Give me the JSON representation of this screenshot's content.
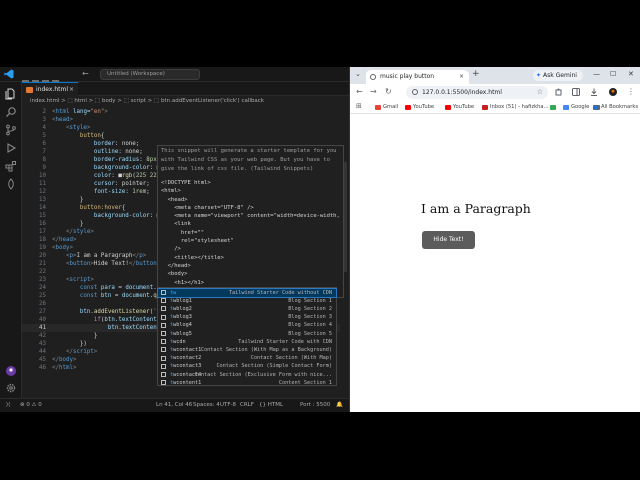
{
  "vscode": {
    "search_placeholder": "Untitled (Workspace)",
    "tab_label": "index.html",
    "tab_close": "×",
    "breadcrumb": "index.html > ⬚ html > ⬚ body > ⬚ script > ⬚ btn.addEventListener('click') callback",
    "lines": [
      {
        "n": "2",
        "html": "<span class='t-gray'>&lt;</span><span class='t-tag'>html</span> <span class='t-attr'>lang</span><span class='t-txt'>=</span><span class='t-str'>\"en\"</span><span class='t-gray'>&gt;</span>"
      },
      {
        "n": "3",
        "html": "<span class='t-gray'>&lt;</span><span class='t-tag'>head</span><span class='t-gray'>&gt;</span>"
      },
      {
        "n": "4",
        "html": "    <span class='t-gray'>&lt;</span><span class='t-tag'>style</span><span class='t-gray'>&gt;</span>"
      },
      {
        "n": "5",
        "html": "        <span class='t-sel'>button</span><span class='t-txt'>{</span>"
      },
      {
        "n": "6",
        "html": "            <span class='t-prop'>border</span><span class='t-txt'>: none;</span>"
      },
      {
        "n": "7",
        "html": "            <span class='t-prop'>outline</span><span class='t-txt'>: none;</span>"
      },
      {
        "n": "8",
        "html": "            <span class='t-prop'>border-radius</span><span class='t-txt'>: </span><span class='t-num'>8px</span><span class='t-txt'>;</span>"
      },
      {
        "n": "9",
        "html": "            <span class='t-prop'>background-color</span><span class='t-txt'>: □</span>"
      },
      {
        "n": "10",
        "html": "            <span class='t-prop'>color</span><span class='t-txt'>: ■</span><span class='t-fn'>rgb</span><span class='t-txt'>(</span><span class='t-num'>225 225</span>"
      },
      {
        "n": "11",
        "html": "            <span class='t-prop'>cursor</span><span class='t-txt'>: pointer;</span>"
      },
      {
        "n": "12",
        "html": "            <span class='t-prop'>font-size</span><span class='t-txt'>: </span><span class='t-num'>1rem</span><span class='t-txt'>;</span>"
      },
      {
        "n": "13",
        "html": "        <span class='t-txt'>}</span>"
      },
      {
        "n": "14",
        "html": "        <span class='t-sel'>button:hover</span><span class='t-txt'>{</span>"
      },
      {
        "n": "15",
        "html": "            <span class='t-prop'>background-color</span><span class='t-txt'>: □</span>"
      },
      {
        "n": "16",
        "html": "        <span class='t-txt'>}</span>"
      },
      {
        "n": "17",
        "html": "    <span class='t-gray'>&lt;/</span><span class='t-tag'>style</span><span class='t-gray'>&gt;</span>"
      },
      {
        "n": "18",
        "html": "<span class='t-gray'>&lt;/</span><span class='t-tag'>head</span><span class='t-gray'>&gt;</span>"
      },
      {
        "n": "19",
        "html": "<span class='t-gray'>&lt;</span><span class='t-tag'>body</span><span class='t-gray'>&gt;</span>"
      },
      {
        "n": "20",
        "html": "    <span class='t-gray'>&lt;</span><span class='t-tag'>p</span><span class='t-gray'>&gt;</span><span class='t-txt'>I am a Paragraph</span><span class='t-gray'>&lt;/</span><span class='t-tag'>p</span><span class='t-gray'>&gt;</span>"
      },
      {
        "n": "21",
        "html": "    <span class='t-gray'>&lt;</span><span class='t-tag'>button</span><span class='t-gray'>&gt;</span><span class='t-txt'>Hide Text!</span><span class='t-gray'>&lt;/</span><span class='t-tag'>button</span><span class='t-gray'>&gt;</span>"
      },
      {
        "n": "22",
        "html": ""
      },
      {
        "n": "23",
        "html": "    <span class='t-gray'>&lt;</span><span class='t-tag'>script</span><span class='t-gray'>&gt;</span>"
      },
      {
        "n": "24",
        "html": "        <span class='t-kw'>const</span> <span class='t-prop'>para</span> <span class='t-txt'>= </span><span class='t-prop'>document</span><span class='t-txt'>.</span><span class='t-fn'>que</span>"
      },
      {
        "n": "25",
        "html": "        <span class='t-kw'>const</span> <span class='t-prop'>btn</span> <span class='t-txt'>= </span><span class='t-prop'>document</span><span class='t-txt'>.</span><span class='t-fn'>que</span>"
      },
      {
        "n": "26",
        "html": ""
      },
      {
        "n": "27",
        "html": "        <span class='t-prop'>btn</span><span class='t-txt'>.</span><span class='t-fn'>addEventListener</span><span class='t-txt'>(</span><span class='t-str'>'cli</span>"
      },
      {
        "n": "40",
        "html": "            <span class='t-ctl'>if</span><span class='t-txt'>(</span><span class='t-prop'>btn</span><span class='t-txt'>.</span><span class='t-prop'>textContent</span> <span class='t-txt'>==</span>"
      },
      {
        "n": "41",
        "html": "                <span class='t-prop'>btn</span><span class='t-txt'>.</span><span class='t-prop'>textContent</span> <span class='t-txt'>= </span><span class='t-str'>\"Show Text!\"</span>"
      },
      {
        "n": "42",
        "html": "            <span class='t-txt'>}</span>"
      },
      {
        "n": "43",
        "html": "        <span class='t-txt'>})</span>"
      },
      {
        "n": "44",
        "html": "    <span class='t-gray'>&lt;/</span><span class='t-tag'>script</span><span class='t-gray'>&gt;</span>"
      },
      {
        "n": "45",
        "html": "<span class='t-gray'>&lt;/</span><span class='t-tag'>body</span><span class='t-gray'>&gt;</span>"
      },
      {
        "n": "46",
        "html": "<span class='t-gray'>&lt;/</span><span class='t-tag'>html</span><span class='t-gray'>&gt;</span>"
      }
    ],
    "hover": {
      "desc": "This snippet will generate a starter template for you with Tailwind CSS as your web page. But you have to give the link of css file. (Tailwind Snippets)",
      "code": [
        "<!DOCTYPE html>",
        "<html>",
        "  <head>",
        "    <meta charset=\"UTF-8\" />",
        "    <meta name=\"viewport\" content=\"width=device-width,",
        "    <link",
        "      href=\"\"",
        "      rel=\"stylesheet\"",
        "    />",
        "    <title></title>",
        "  </head>",
        "  <body>",
        "    <h1></h1>",
        "  </body>"
      ]
    },
    "suggestions": [
      {
        "label_match": "tw",
        "label_rest": "",
        "detail": "Tailwind Starter Code without CDN"
      },
      {
        "label_match": "t",
        "label_rest": "wblog1",
        "detail": "Blog Section 1"
      },
      {
        "label_match": "t",
        "label_rest": "wblog2",
        "detail": "Blog Section 2"
      },
      {
        "label_match": "t",
        "label_rest": "wblog3",
        "detail": "Blog Section 3"
      },
      {
        "label_match": "t",
        "label_rest": "wblog4",
        "detail": "Blog Section 4"
      },
      {
        "label_match": "t",
        "label_rest": "wblog5",
        "detail": "Blog Section 5"
      },
      {
        "label_match": "t",
        "label_rest": "wcdn",
        "detail": "Tailwind Starter Code with CDN"
      },
      {
        "label_match": "t",
        "label_rest": "wcontact1",
        "detail": "Contact Section (With Map as a Background)"
      },
      {
        "label_match": "t",
        "label_rest": "wcontact2",
        "detail": "Contact Section (With Map)"
      },
      {
        "label_match": "t",
        "label_rest": "wcontact3",
        "detail": "Contact Section (Simple Contact Form)"
      },
      {
        "label_match": "t",
        "label_rest": "wcontact4",
        "detail": "Contact Section (Exclusive Form with nice..."
      },
      {
        "label_match": "t",
        "label_rest": "wcontent1",
        "detail": "Content Section 1"
      }
    ],
    "status": {
      "errors": "⊗ 0 ⚠ 0",
      "cursor": "Ln 41, Col 46",
      "spaces": "Spaces: 4",
      "encoding": "UTF-8",
      "eol": "CRLF",
      "language": "{} HTML",
      "port": "Port : 5500",
      "bell": "🔔"
    }
  },
  "chrome": {
    "tab_title": "music play button",
    "tab_close": "×",
    "new_tab": "+",
    "gemini": "Ask Gemini",
    "url": "127.0.0.1:5500/index.html",
    "bookmarks": [
      {
        "label": "Gmail",
        "color": "#ea4335"
      },
      {
        "label": "YouTube",
        "color": "#ff0000"
      },
      {
        "label": "YouTube",
        "color": "#ff0000"
      },
      {
        "label": "Inbox (51) - hafizkha...",
        "color": "#c5221f"
      },
      {
        "label": "",
        "color": "#34a853"
      },
      {
        "label": "Google",
        "color": "#4285f4"
      },
      {
        "label": "",
        "color": "#1a73e8"
      }
    ],
    "all_bookmarks": "All Bookmarks",
    "page": {
      "paragraph": "I am a Paragraph",
      "button": "Hide Text!"
    }
  },
  "colors": {
    "vscode_bg": "#1f1f1f",
    "accent": "#0078d4",
    "suggest_selected": "#04395e",
    "page_button_bg": "#5c5c5c"
  }
}
